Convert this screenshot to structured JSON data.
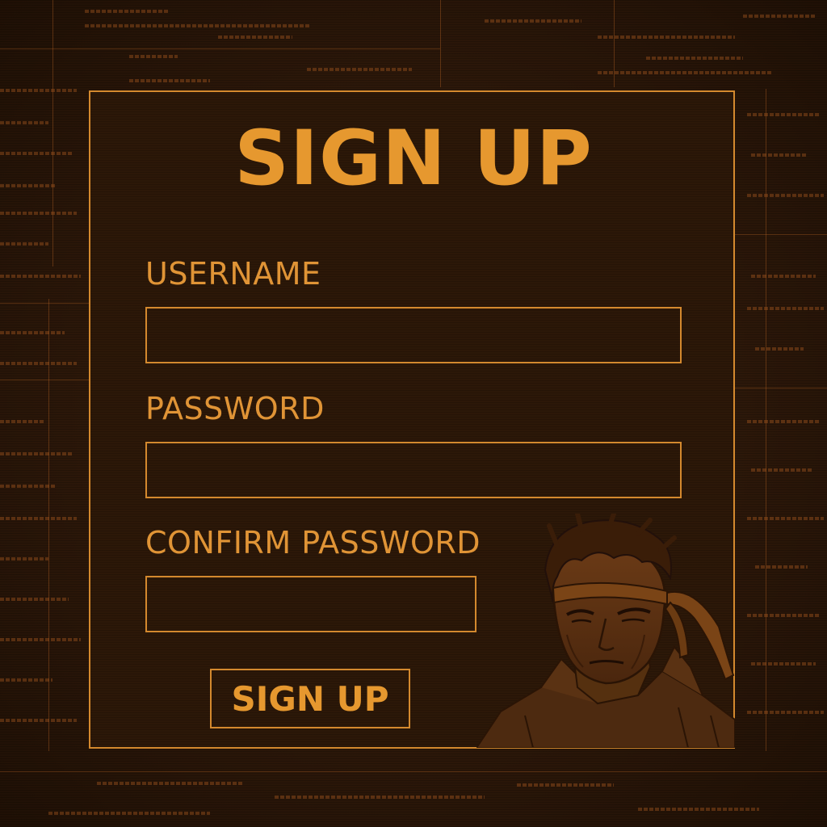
{
  "form": {
    "title": "SIGN UP",
    "username_label": "USERNAME",
    "username_value": "",
    "password_label": "PASSWORD",
    "password_value": "",
    "confirm_label": "CONFIRM PASSWORD",
    "confirm_value": "",
    "submit_label": "SIGN UP"
  },
  "illustration": {
    "icon": "soldier-portrait-icon"
  },
  "colors": {
    "accent": "#d4892e",
    "text": "#e6982f",
    "background": "#2a1608"
  }
}
